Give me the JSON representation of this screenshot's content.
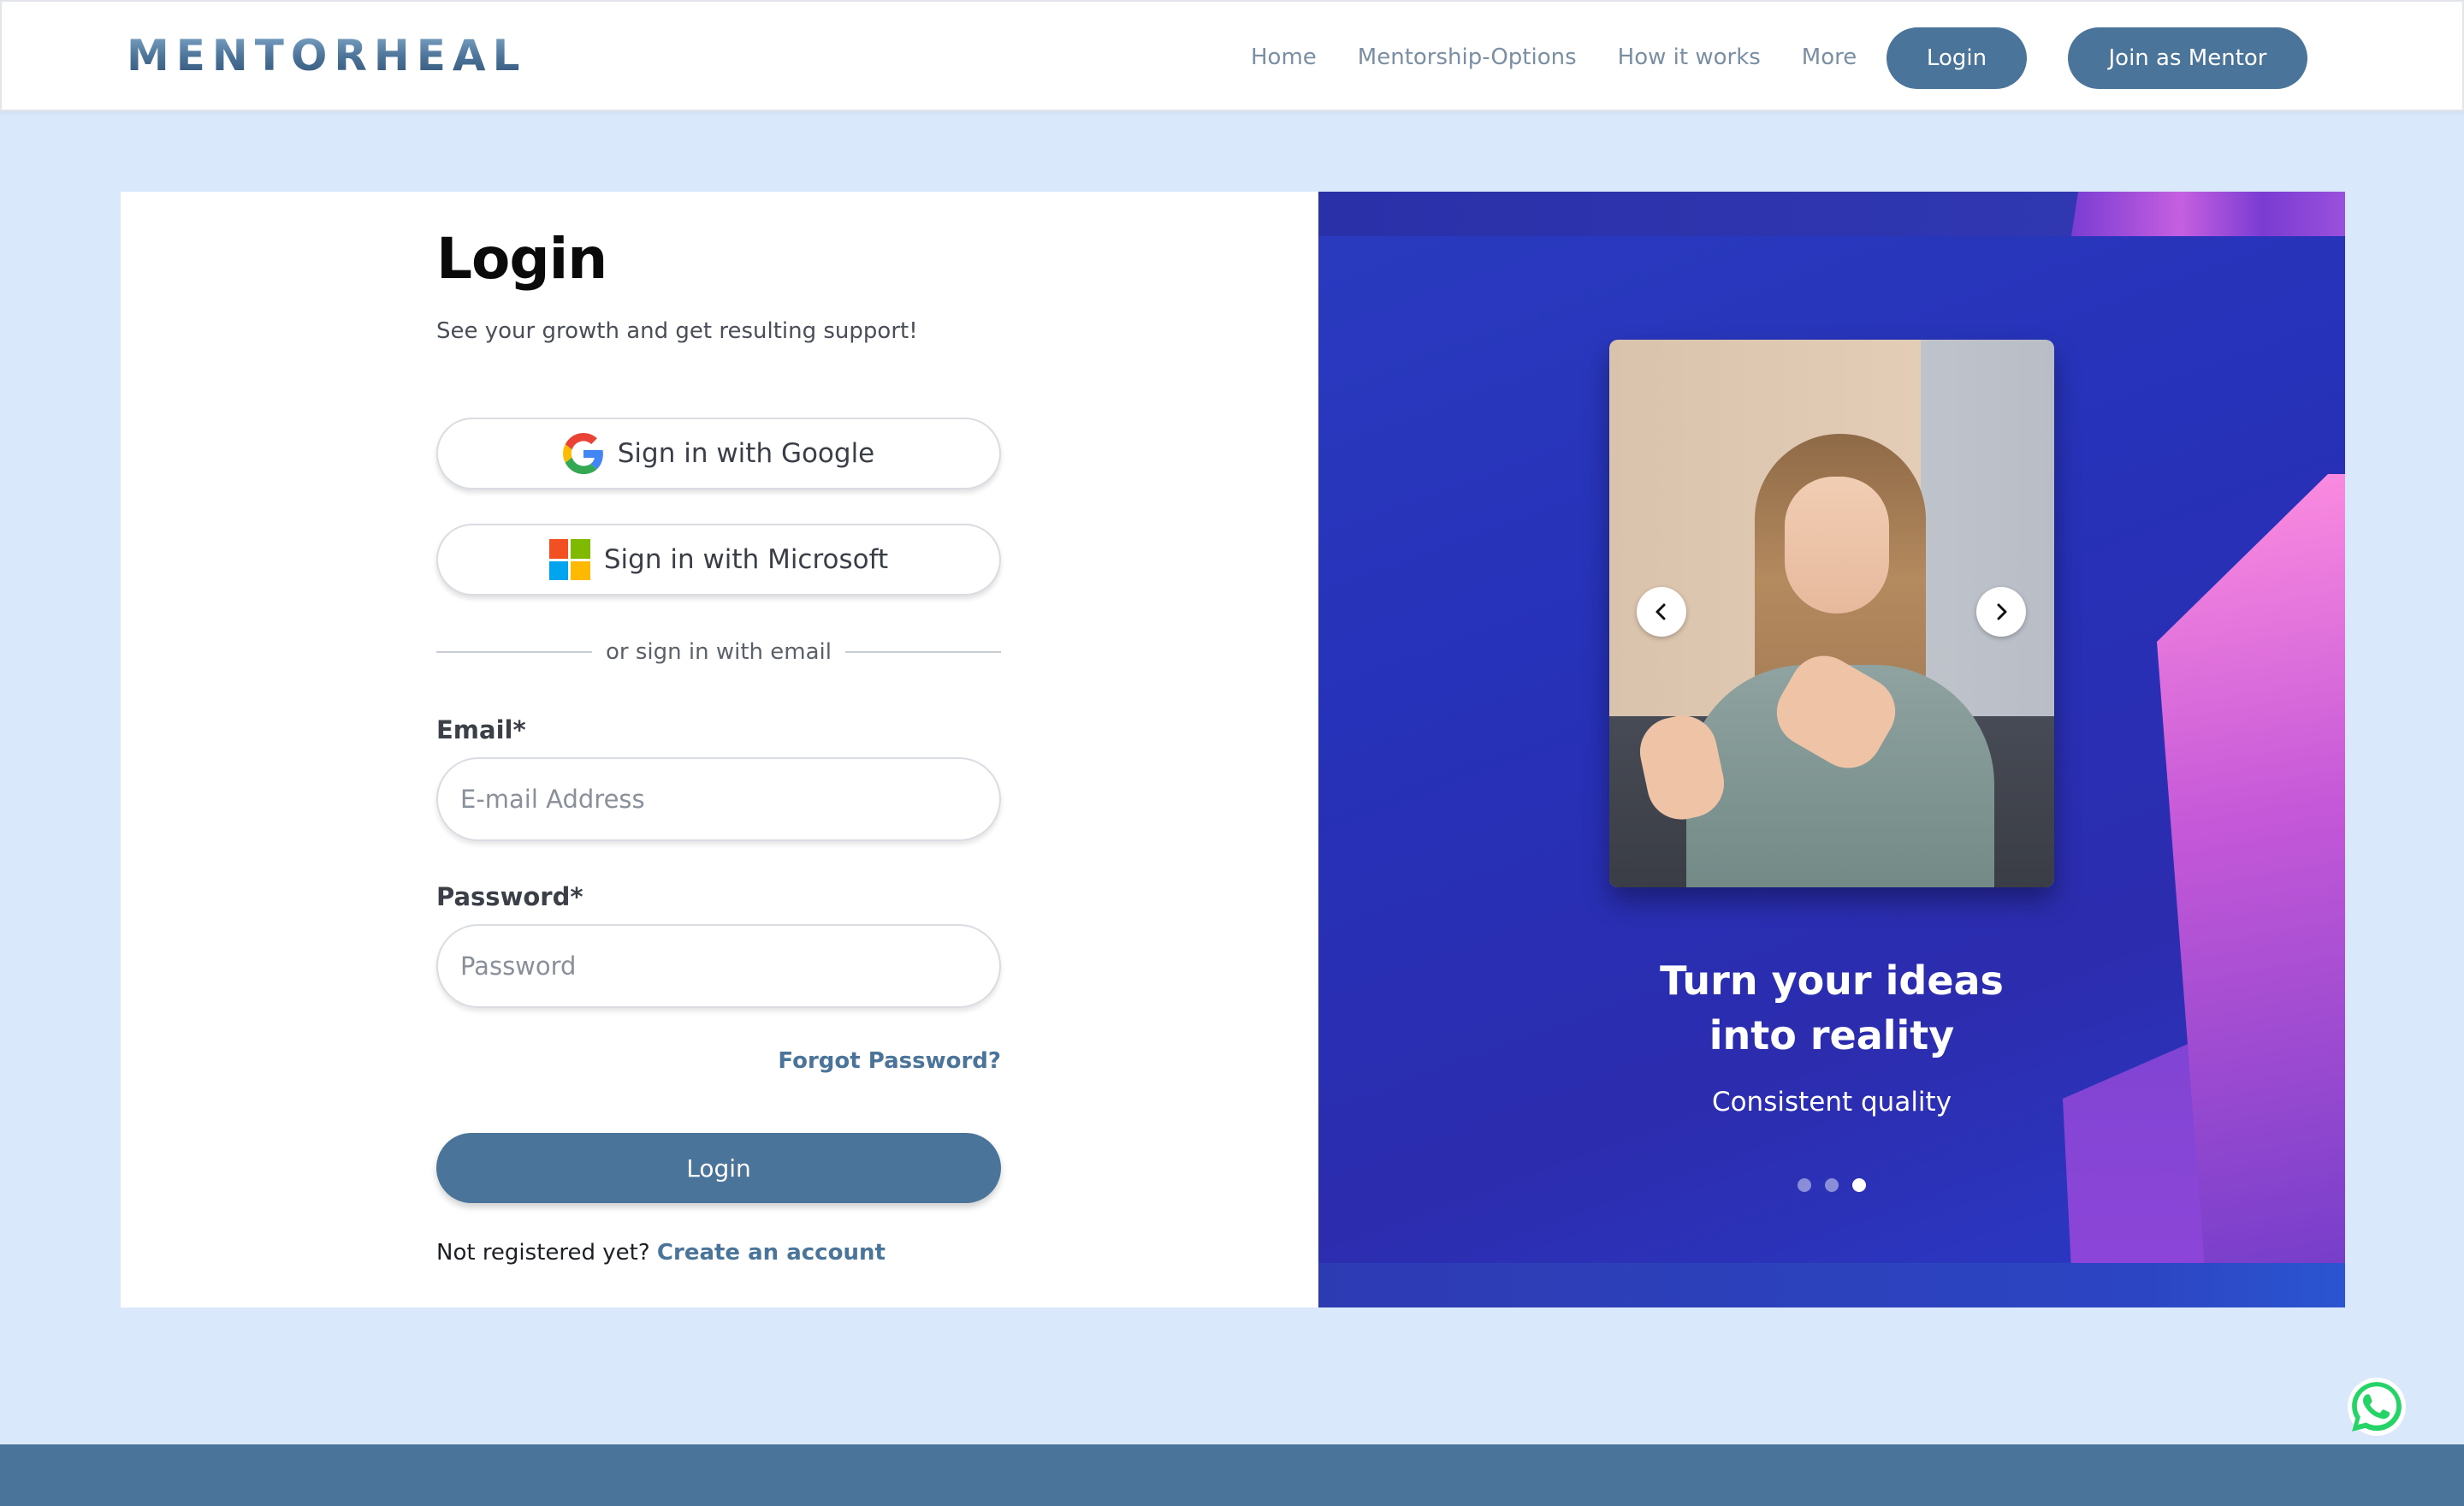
{
  "header": {
    "logo": "MENTORHEAL",
    "nav": [
      "Home",
      "Mentorship-Options",
      "How it works",
      "More"
    ],
    "login_label": "Login",
    "mentor_label": "Join as Mentor"
  },
  "login": {
    "title": "Login",
    "subtitle": "See your growth and get resulting support!",
    "google_label": "Sign in with Google",
    "microsoft_label": "Sign in with Microsoft",
    "divider": "or sign in with email",
    "email_label": "Email*",
    "email_placeholder": "E-mail Address",
    "password_label": "Password*",
    "password_placeholder": "Password",
    "forgot": "Forgot Password?",
    "submit": "Login",
    "register_prefix": "Not registered yet?",
    "register_link": "Create an account"
  },
  "carousel": {
    "title": "Turn your ideas\ninto reality",
    "subtitle": "Consistent quality",
    "slides": 3,
    "active_slide": 3
  },
  "colors": {
    "brand": "#4a7499",
    "page_bg": "#dae8fc",
    "carousel_bg": "#2a37b8"
  }
}
